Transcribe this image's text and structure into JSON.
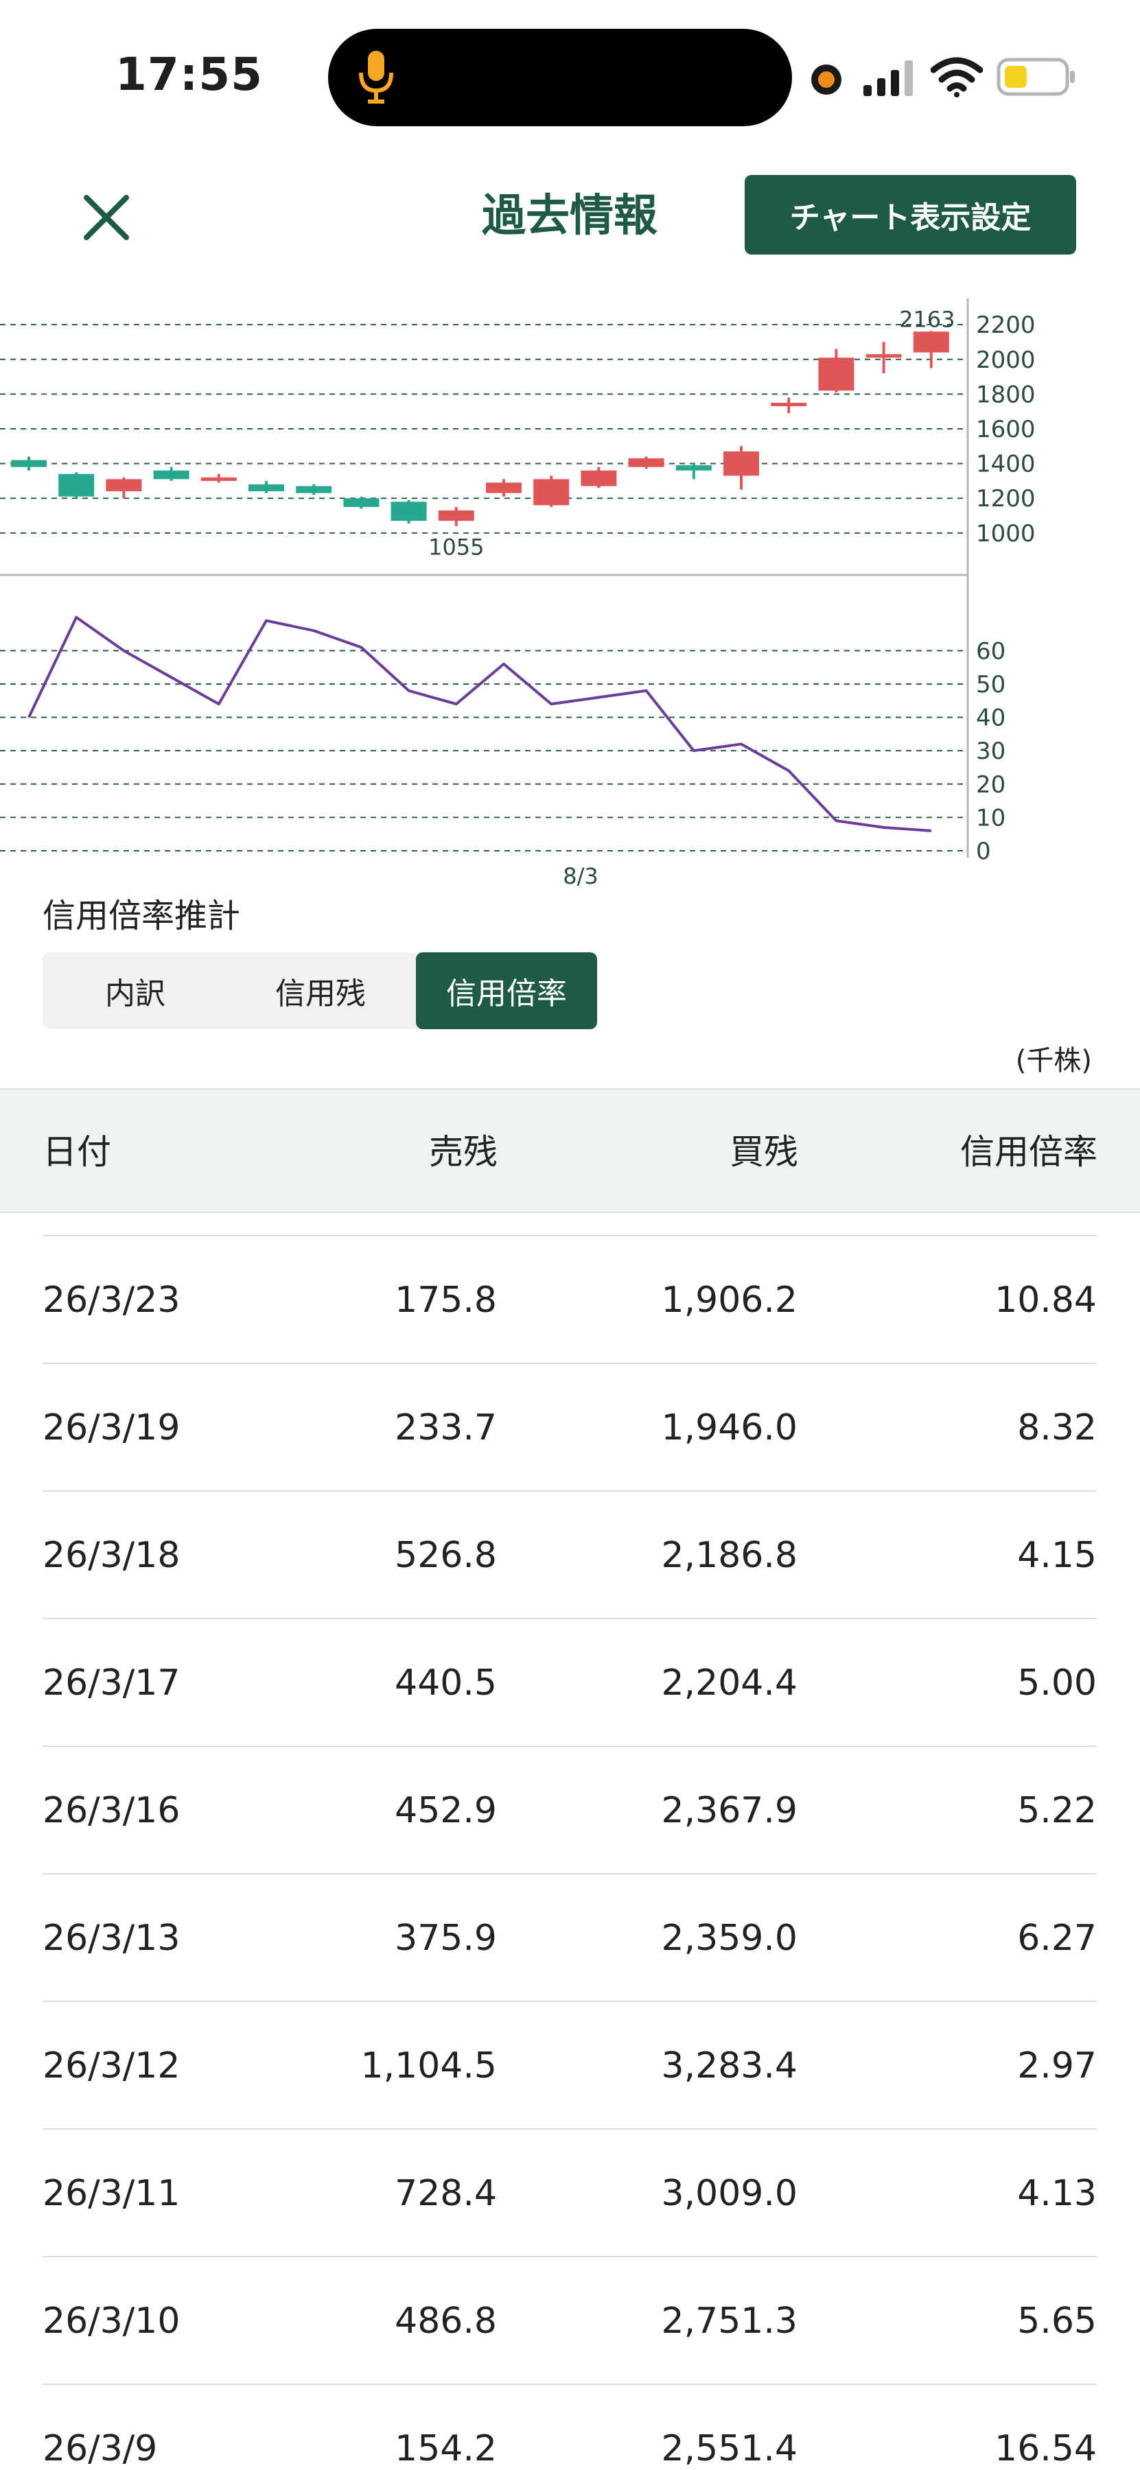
{
  "status_bar": {
    "time": "17:55"
  },
  "header": {
    "title": "過去情報",
    "settings_label": "チャート表示設定"
  },
  "colors": {
    "accent": "#1e5a47",
    "candle_up": "#e05555",
    "candle_down": "#28a88e",
    "ratio_line": "#6a3d9a"
  },
  "chart_data": [
    {
      "type": "candlestick",
      "y_ticks": [
        1000,
        1200,
        1400,
        1600,
        1800,
        2000,
        2200
      ],
      "ylim": [
        940,
        2260
      ],
      "high_label": "2163",
      "low_label": "1055",
      "candles": [
        {
          "open": 1420,
          "close": 1380,
          "high": 1440,
          "low": 1360
        },
        {
          "open": 1340,
          "close": 1210,
          "high": 1350,
          "low": 1200
        },
        {
          "open": 1240,
          "close": 1310,
          "high": 1320,
          "low": 1200
        },
        {
          "open": 1360,
          "close": 1310,
          "high": 1380,
          "low": 1300
        },
        {
          "open": 1300,
          "close": 1320,
          "high": 1340,
          "low": 1290
        },
        {
          "open": 1280,
          "close": 1240,
          "high": 1300,
          "low": 1230
        },
        {
          "open": 1270,
          "close": 1230,
          "high": 1280,
          "low": 1220
        },
        {
          "open": 1200,
          "close": 1150,
          "high": 1210,
          "low": 1140
        },
        {
          "open": 1180,
          "close": 1070,
          "high": 1190,
          "low": 1055
        },
        {
          "open": 1070,
          "close": 1130,
          "high": 1150,
          "low": 1040
        },
        {
          "open": 1230,
          "close": 1290,
          "high": 1310,
          "low": 1210
        },
        {
          "open": 1160,
          "close": 1310,
          "high": 1330,
          "low": 1150
        },
        {
          "open": 1270,
          "close": 1360,
          "high": 1380,
          "low": 1260
        },
        {
          "open": 1380,
          "close": 1430,
          "high": 1440,
          "low": 1370
        },
        {
          "open": 1390,
          "close": 1360,
          "high": 1400,
          "low": 1310
        },
        {
          "open": 1330,
          "close": 1470,
          "high": 1500,
          "low": 1250
        },
        {
          "open": 1740,
          "close": 1750,
          "high": 1780,
          "low": 1690
        },
        {
          "open": 1820,
          "close": 2010,
          "high": 2060,
          "low": 1810
        },
        {
          "open": 2010,
          "close": 2030,
          "high": 2100,
          "low": 1920
        },
        {
          "open": 2040,
          "close": 2160,
          "high": 2163,
          "low": 1950
        }
      ]
    },
    {
      "type": "line",
      "series_name": "信用倍率",
      "y_ticks": [
        0,
        10,
        20,
        30,
        40,
        50,
        60
      ],
      "ylim": [
        0,
        72
      ],
      "x_label": "8/3",
      "values": [
        40,
        70,
        60,
        52,
        44,
        69,
        66,
        61,
        48,
        44,
        56,
        44,
        46,
        48,
        30,
        32,
        24,
        9,
        7,
        6
      ]
    }
  ],
  "section": {
    "title": "信用倍率推計",
    "tabs": [
      "内訳",
      "信用残",
      "信用倍率"
    ],
    "active_tab": 2,
    "unit": "(千株)"
  },
  "table": {
    "columns": [
      "日付",
      "売残",
      "買残",
      "信用倍率"
    ],
    "rows": [
      [
        "26/3/23",
        "175.8",
        "1,906.2",
        "10.84"
      ],
      [
        "26/3/19",
        "233.7",
        "1,946.0",
        "8.32"
      ],
      [
        "26/3/18",
        "526.8",
        "2,186.8",
        "4.15"
      ],
      [
        "26/3/17",
        "440.5",
        "2,204.4",
        "5.00"
      ],
      [
        "26/3/16",
        "452.9",
        "2,367.9",
        "5.22"
      ],
      [
        "26/3/13",
        "375.9",
        "2,359.0",
        "6.27"
      ],
      [
        "26/3/12",
        "1,104.5",
        "3,283.4",
        "2.97"
      ],
      [
        "26/3/11",
        "728.4",
        "3,009.0",
        "4.13"
      ],
      [
        "26/3/10",
        "486.8",
        "2,751.3",
        "5.65"
      ],
      [
        "26/3/9",
        "154.2",
        "2,551.4",
        "16.54"
      ]
    ]
  }
}
